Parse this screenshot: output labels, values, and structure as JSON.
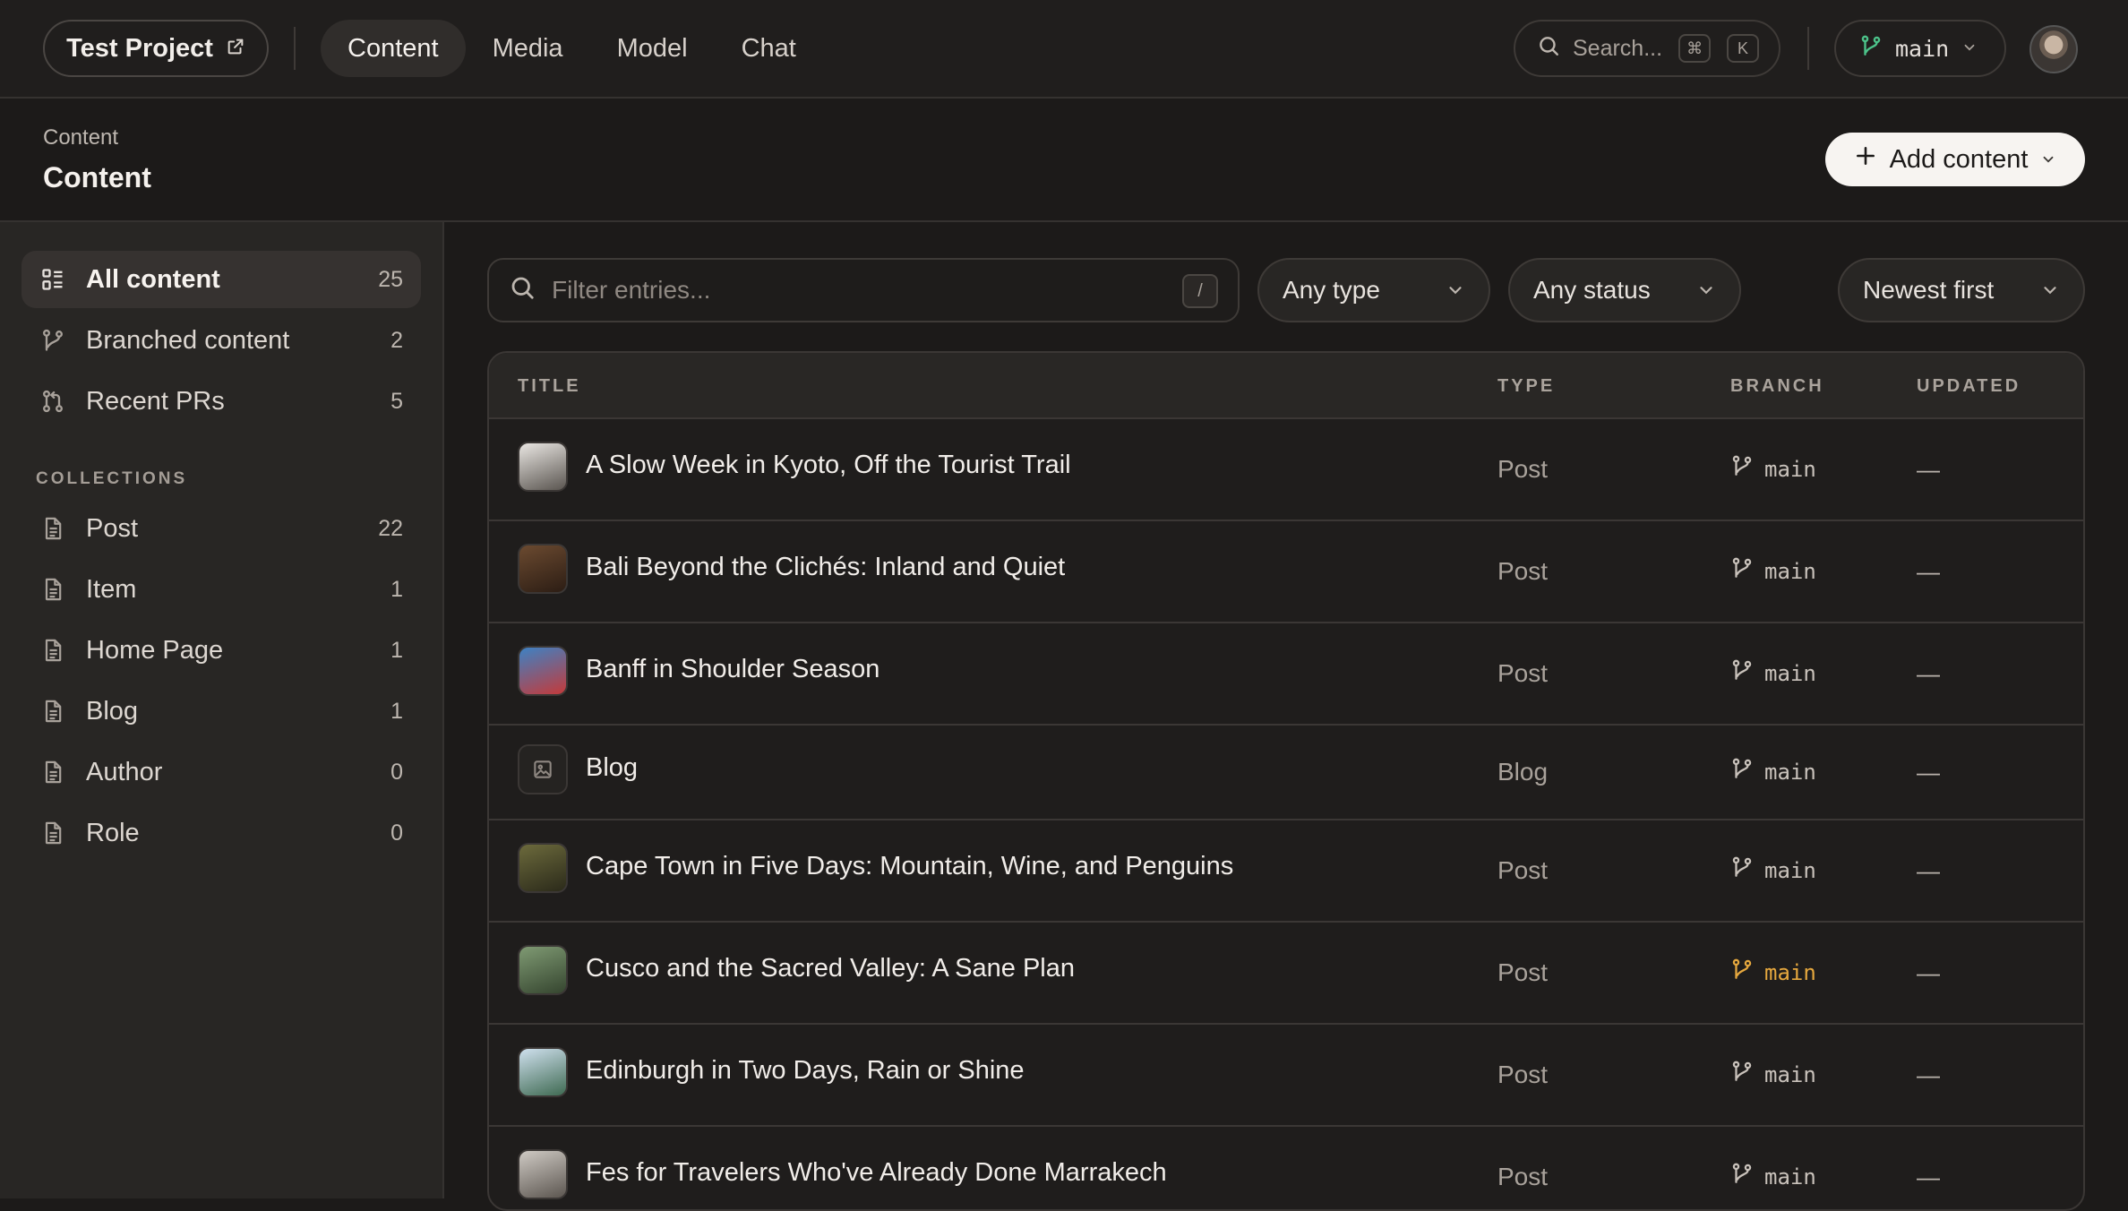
{
  "topbar": {
    "project_name": "Test Project",
    "nav": [
      "Content",
      "Media",
      "Model",
      "Chat"
    ],
    "active_nav": "Content",
    "search_placeholder": "Search...",
    "search_shortcut": [
      "⌘",
      "K"
    ],
    "branch": "main"
  },
  "page": {
    "breadcrumb": "Content",
    "title": "Content",
    "add_button": "Add content"
  },
  "sidebar": {
    "items": [
      {
        "label": "All content",
        "count": "25",
        "icon": "grid-list-icon"
      },
      {
        "label": "Branched content",
        "count": "2",
        "icon": "git-branch-icon"
      },
      {
        "label": "Recent PRs",
        "count": "5",
        "icon": "git-pull-request-icon"
      }
    ],
    "collections_heading": "COLLECTIONS",
    "collections": [
      {
        "label": "Post",
        "count": "22"
      },
      {
        "label": "Item",
        "count": "1"
      },
      {
        "label": "Home Page",
        "count": "1"
      },
      {
        "label": "Blog",
        "count": "1"
      },
      {
        "label": "Author",
        "count": "0"
      },
      {
        "label": "Role",
        "count": "0"
      }
    ]
  },
  "filters": {
    "search_placeholder": "Filter entries...",
    "search_shortcut": "/",
    "type": "Any type",
    "status": "Any status",
    "sort": "Newest first"
  },
  "table": {
    "columns": [
      "TITLE",
      "TYPE",
      "BRANCH",
      "UPDATED"
    ],
    "rows": [
      {
        "title": "A Slow Week in Kyoto, Off the Tourist Trail",
        "type": "Post",
        "branch": "main",
        "updated": "—",
        "thumb": [
          "#e9e6e2",
          "#5a5550"
        ]
      },
      {
        "title": "Bali Beyond the Clichés: Inland and Quiet",
        "type": "Post",
        "branch": "main",
        "updated": "—",
        "thumb": [
          "#6b4a30",
          "#2c1d14"
        ]
      },
      {
        "title": "Banff in Shoulder Season",
        "type": "Post",
        "branch": "main",
        "updated": "—",
        "thumb": [
          "#3d82c4",
          "#c43a3a"
        ]
      },
      {
        "title": "Blog",
        "type": "Blog",
        "branch": "main",
        "updated": "—",
        "thumb": null
      },
      {
        "title": "Cape Town in Five Days: Mountain, Wine, and Penguins",
        "type": "Post",
        "branch": "main",
        "updated": "—",
        "thumb": [
          "#6c6a3c",
          "#2b2a1a"
        ]
      },
      {
        "title": "Cusco and the Sacred Valley: A Sane Plan",
        "type": "Post",
        "branch": "main",
        "updated": "—",
        "thumb": [
          "#7f9a73",
          "#35452f"
        ],
        "branch_warning": true
      },
      {
        "title": "Edinburgh in Two Days, Rain or Shine",
        "type": "Post",
        "branch": "main",
        "updated": "—",
        "thumb": [
          "#cfe0ee",
          "#3f6a52"
        ]
      },
      {
        "title": "Fes for Travelers Who've Already Done Marrakech",
        "type": "Post",
        "branch": "main",
        "updated": "—",
        "thumb": [
          "#cfcac4",
          "#5c5650"
        ]
      }
    ]
  },
  "colors": {
    "accent_green": "#4cc38a",
    "warning_amber": "#e6a83e"
  }
}
